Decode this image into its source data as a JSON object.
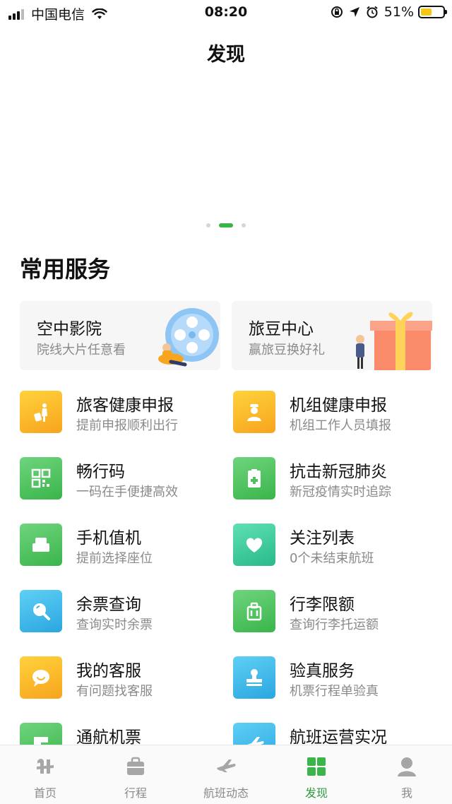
{
  "status_bar": {
    "carrier": "中国电信",
    "time": "08:20",
    "battery_percent": "51%",
    "battery_level": 0.51,
    "icons": [
      "signal-icon",
      "wifi-icon",
      "orientation-lock-icon",
      "location-icon",
      "alarm-icon",
      "battery-icon"
    ]
  },
  "header": {
    "title": "发现"
  },
  "banner": {
    "page_count": 3,
    "active_index": 1
  },
  "section": {
    "title": "常用服务"
  },
  "featured": [
    {
      "title": "空中影院",
      "subtitle": "院线大片任意看",
      "icon": "film-reel-icon"
    },
    {
      "title": "旅豆中心",
      "subtitle": "赢旅豆换好礼",
      "icon": "gift-box-icon"
    }
  ],
  "services": [
    {
      "title": "旅客健康申报",
      "subtitle": "提前申报顺利出行",
      "icon": "traveler-icon",
      "color": "#f9b62a"
    },
    {
      "title": "机组健康申报",
      "subtitle": "机组工作人员填报",
      "icon": "pilot-icon",
      "color": "#f9b62a"
    },
    {
      "title": "畅行码",
      "subtitle": "一码在手便捷高效",
      "icon": "qr-code-icon",
      "color": "#4fc15f"
    },
    {
      "title": "抗击新冠肺炎",
      "subtitle": "新冠疫情实时追踪",
      "icon": "medical-clipboard-icon",
      "color": "#4fc15f"
    },
    {
      "title": "手机值机",
      "subtitle": "提前选择座位",
      "icon": "seat-icon",
      "color": "#4fc15f"
    },
    {
      "title": "关注列表",
      "subtitle": "0个未结束航班",
      "icon": "heart-icon",
      "color": "#3fcf9c"
    },
    {
      "title": "余票查询",
      "subtitle": "查询实时余票",
      "icon": "magnifier-icon",
      "color": "#39b6ea"
    },
    {
      "title": "行李限额",
      "subtitle": "查询行李托运额",
      "icon": "luggage-icon",
      "color": "#4fc15f"
    },
    {
      "title": "我的客服",
      "subtitle": "有问题找客服",
      "icon": "chat-smile-icon",
      "color": "#f9b62a"
    },
    {
      "title": "验真服务",
      "subtitle": "机票行程单验真",
      "icon": "stamp-icon",
      "color": "#39b6ea"
    },
    {
      "title": "通航机票",
      "subtitle": "",
      "icon": "general-aviation-icon",
      "color": "#4fc15f"
    },
    {
      "title": "航班运营实况",
      "subtitle": "",
      "icon": "plane-icon",
      "color": "#39b6ea"
    }
  ],
  "tabbar": {
    "items": [
      {
        "label": "首页",
        "icon": "home-logo-icon",
        "active": false
      },
      {
        "label": "行程",
        "icon": "briefcase-icon",
        "active": false
      },
      {
        "label": "航班动态",
        "icon": "plane-icon",
        "active": false
      },
      {
        "label": "发现",
        "icon": "grid-icon",
        "active": true
      },
      {
        "label": "我",
        "icon": "person-icon",
        "active": false
      }
    ]
  }
}
